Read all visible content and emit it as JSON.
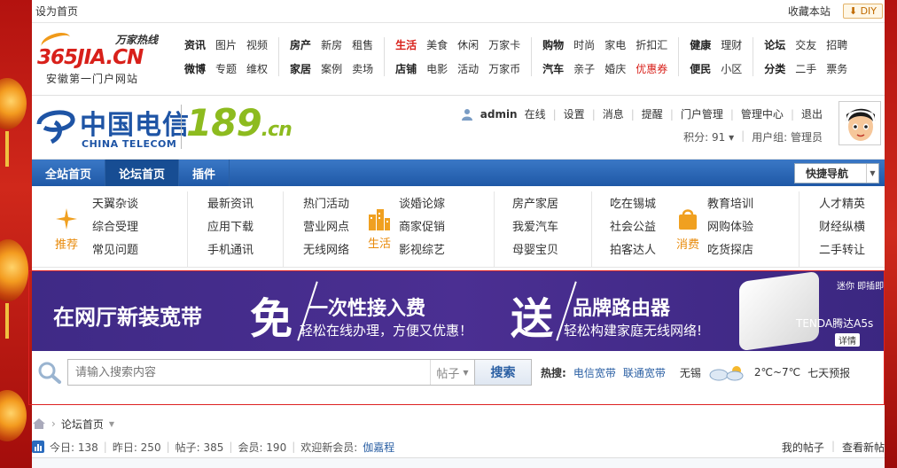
{
  "topbar": {
    "set_home": "设为首页",
    "bookmark": "收藏本站",
    "diy": "DIY"
  },
  "logo365": {
    "slogan": "万家热线",
    "brand": "365JIA.CN",
    "sub": "安徽第一门户网站"
  },
  "navgroups": [
    {
      "rows": [
        [
          "资讯",
          "图片",
          "视频"
        ],
        [
          "微博",
          "专题",
          "维权"
        ]
      ]
    },
    {
      "rows": [
        [
          "房产",
          "新房",
          "租售"
        ],
        [
          "家居",
          "案例",
          "卖场"
        ]
      ]
    },
    {
      "rows": [
        [
          "生活",
          "美食",
          "休闲",
          "万家卡"
        ],
        [
          "店铺",
          "电影",
          "活动",
          "万家币"
        ]
      ]
    },
    {
      "rows": [
        [
          "购物",
          "时尚",
          "家电",
          "折扣汇"
        ],
        [
          "汽车",
          "亲子",
          "婚庆",
          "优惠券"
        ]
      ]
    },
    {
      "rows": [
        [
          "健康",
          "理财"
        ],
        [
          "便民",
          "小区"
        ]
      ]
    },
    {
      "rows": [
        [
          "论坛",
          "交友",
          "招聘"
        ],
        [
          "分类",
          "二手",
          "票务"
        ]
      ]
    }
  ],
  "telecom": {
    "cn": "中国电信",
    "en": "CHINA TELECOM",
    "num": "189",
    "dotcn": ".cn"
  },
  "user": {
    "name": "admin",
    "online": "在线",
    "links": [
      "设置",
      "消息",
      "提醒",
      "门户管理",
      "管理中心",
      "退出"
    ],
    "points": "积分: 91",
    "group": "用户组: 管理员"
  },
  "mainnav": {
    "tabs": [
      "全站首页",
      "论坛首页",
      "插件"
    ],
    "active_index": 1,
    "quick_nav": "快捷导航"
  },
  "categories": {
    "recommend": "推荐",
    "life": "生活",
    "consume": "消费",
    "cols": [
      [
        "天翼杂谈",
        "综合受理",
        "常见问题"
      ],
      [
        "最新资讯",
        "应用下载",
        "手机通讯"
      ],
      [
        "热门活动",
        "营业网点",
        "无线网络"
      ],
      [
        "谈婚论嫁",
        "商家促销",
        "影视综艺"
      ],
      [
        "房产家居",
        "我爱汽车",
        "母婴宝贝"
      ],
      [
        "吃在锡城",
        "社会公益",
        "拍客达人"
      ],
      [
        "教育培训",
        "网购体验",
        "吃货探店"
      ],
      [
        "人才精英",
        "财经纵横",
        "二手转让"
      ]
    ]
  },
  "banner": {
    "title": "在网厅新装宽带",
    "free": "免",
    "free_head": "一次性接入费",
    "free_sub": "轻松在线办理，方便又优惠！",
    "give": "送",
    "give_head": "品牌路由器",
    "give_sub": "轻松构建家庭无线网络!",
    "tagline": "迷你 即插即用",
    "product": "TENDA腾达A5s",
    "detail": "详情"
  },
  "search": {
    "placeholder": "请输入搜索内容",
    "type": "帖子",
    "button": "搜索",
    "hot_label": "热搜:",
    "hot": [
      "电信宽带",
      "联通宽带"
    ],
    "city": "无锡",
    "temp": "2℃~7℃",
    "forecast": "七天预报"
  },
  "crumb": {
    "current": "论坛首页"
  },
  "stats": {
    "today": "今日: 138",
    "yesterday": "昨日: 250",
    "posts": "帖子: 385",
    "members": "会员: 190",
    "welcome": "欢迎新会员:",
    "new_member": "伽嘉程",
    "my_posts": "我的帖子",
    "view_new": "查看新帖"
  }
}
